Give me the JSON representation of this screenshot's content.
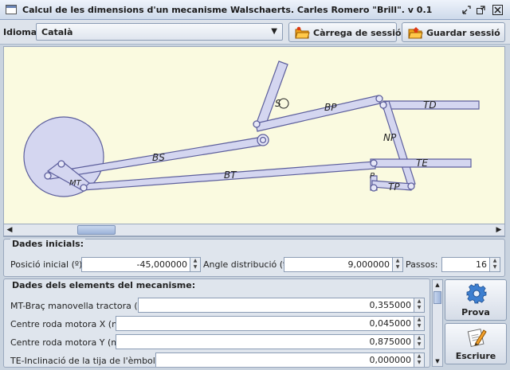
{
  "window": {
    "title": "Calcul de les dimensions d'un mecanisme Walschaerts. Carles Romero \"Brill\". v 0.1",
    "controls": [
      "minimize-icon",
      "maximize-icon",
      "close-icon"
    ]
  },
  "toolbar": {
    "language_label": "Idioma:",
    "language_value": "Català",
    "load_button": "Càrrega de sessió",
    "save_button": "Guardar sessió"
  },
  "diagram": {
    "labels": [
      "BS",
      "BT",
      "BP",
      "S",
      "TD",
      "TE",
      "TP",
      "NP",
      "P",
      "MT"
    ],
    "fill_color": "#d4d6f0",
    "stroke_color": "#5c5e9c",
    "background": "#fafae0"
  },
  "initial": {
    "title": "Dades inicials:",
    "fields": [
      {
        "label": "Posició inicial (º):",
        "value": "-45,000000"
      },
      {
        "label": "Angle distribució (º):",
        "value": "9,000000"
      },
      {
        "label": "Passos:",
        "value": "16"
      }
    ]
  },
  "elements": {
    "title": "Dades dels elements del mecanisme:",
    "rows": [
      {
        "label": "MT-Braç manovella tractora (m):",
        "value": "0,355000"
      },
      {
        "label": "Centre roda motora X (m):",
        "value": "0,045000"
      },
      {
        "label": "Centre roda motora Y (m):",
        "value": "0,875000"
      },
      {
        "label": "TE-Inclinació de la tija de l'èmbol (º):",
        "value": "0,000000"
      }
    ]
  },
  "side_buttons": {
    "test": "Prova",
    "write": "Escriure"
  }
}
